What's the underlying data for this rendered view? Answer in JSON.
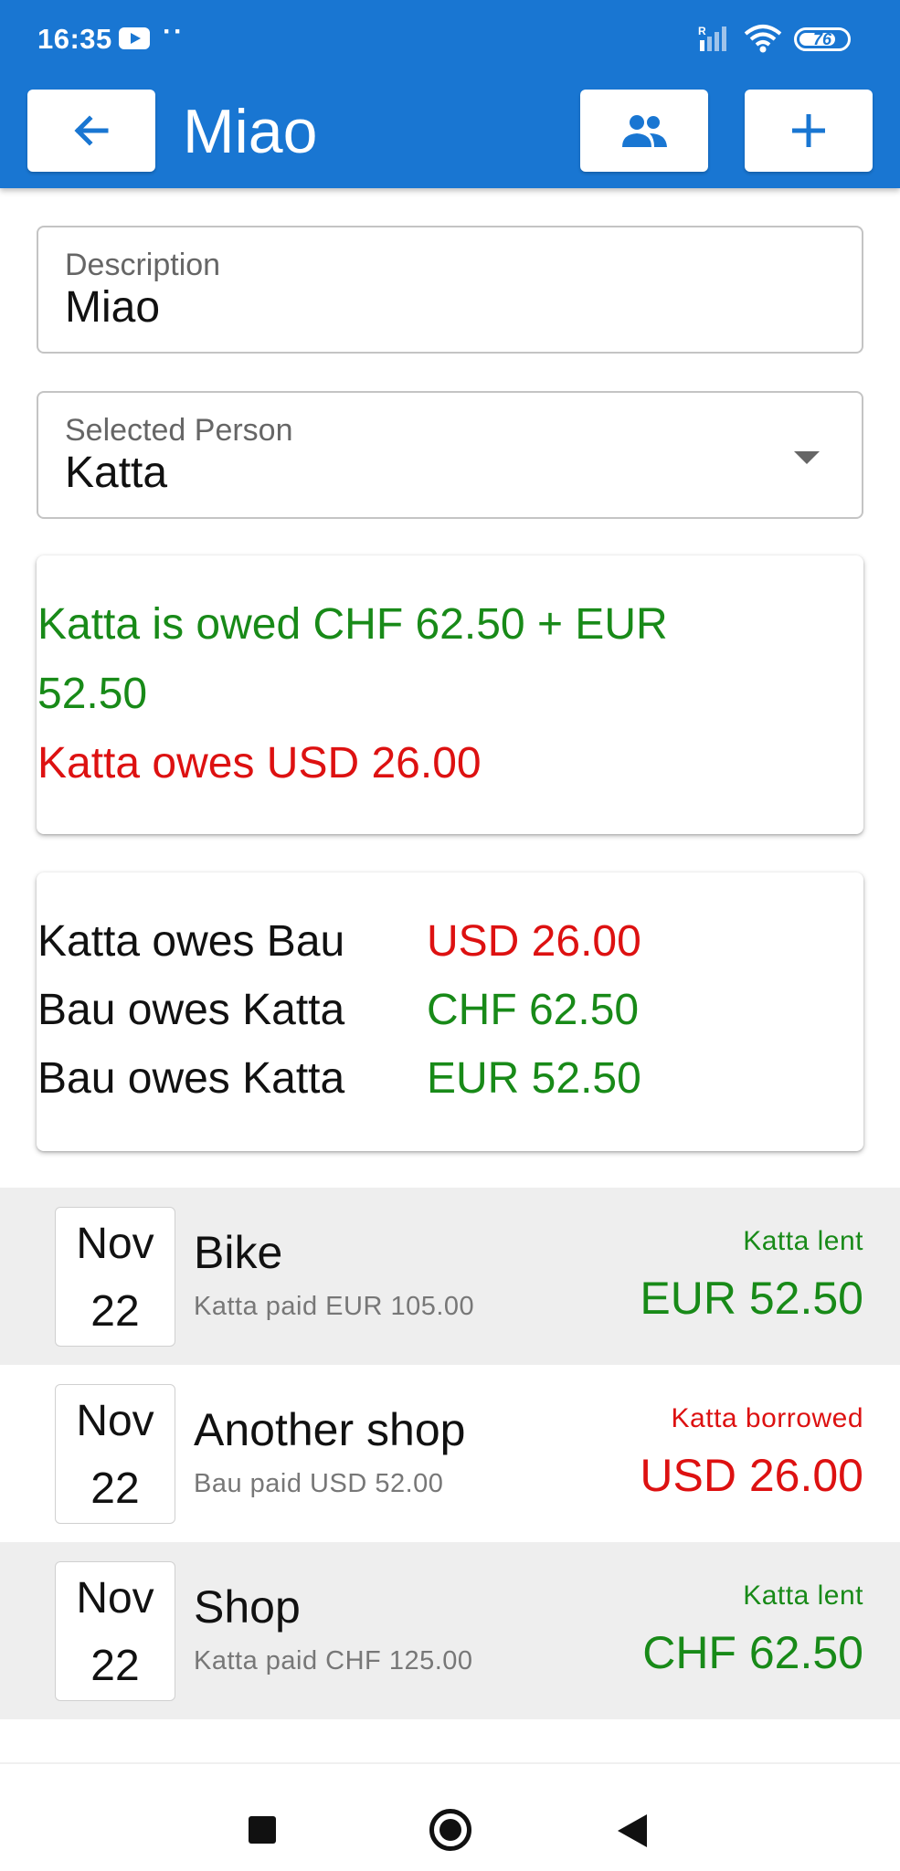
{
  "status_bar": {
    "time": "16:35",
    "dots": "··",
    "battery": "76",
    "icons": [
      "youtube-icon",
      "signal-icon",
      "wifi-icon",
      "battery-icon"
    ]
  },
  "header": {
    "title": "Miao",
    "background": "#1976d2",
    "buttons": [
      {
        "name": "back",
        "icon": "arrow-back-icon"
      },
      {
        "name": "people",
        "icon": "people-icon"
      },
      {
        "name": "add",
        "icon": "plus-icon"
      }
    ]
  },
  "form": {
    "description": {
      "label": "Description",
      "value": "Miao"
    },
    "selected_person": {
      "label": "Selected Person",
      "value": "Katta"
    }
  },
  "summary": {
    "owed": "Katta is owed CHF 62.50 + EUR 52.50",
    "owes": "Katta owes USD 26.00"
  },
  "debts": [
    {
      "description": "Katta owes Bau",
      "amount": "USD 26.00",
      "color": "#dd1111"
    },
    {
      "description": "Bau owes Katta",
      "amount": "CHF 62.50",
      "color": "#188a18"
    },
    {
      "description": "Bau owes Katta",
      "amount": "EUR 52.50",
      "color": "#188a18"
    }
  ],
  "transactions": [
    {
      "month": "Nov",
      "day": "22",
      "title": "Bike",
      "subtitle": "Katta paid EUR 105.00",
      "role": "Katta lent",
      "amount": "EUR 52.50",
      "color": "#188a18"
    },
    {
      "month": "Nov",
      "day": "22",
      "title": "Another shop",
      "subtitle": "Bau paid USD 52.00",
      "role": "Katta borrowed",
      "amount": "USD 26.00",
      "color": "#dd1111"
    },
    {
      "month": "Nov",
      "day": "22",
      "title": "Shop",
      "subtitle": "Katta paid CHF 125.00",
      "role": "Katta lent",
      "amount": "CHF 62.50",
      "color": "#188a18"
    }
  ],
  "colors": {
    "positive": "#188a18",
    "negative": "#dd1111",
    "accent": "#1976d2"
  }
}
